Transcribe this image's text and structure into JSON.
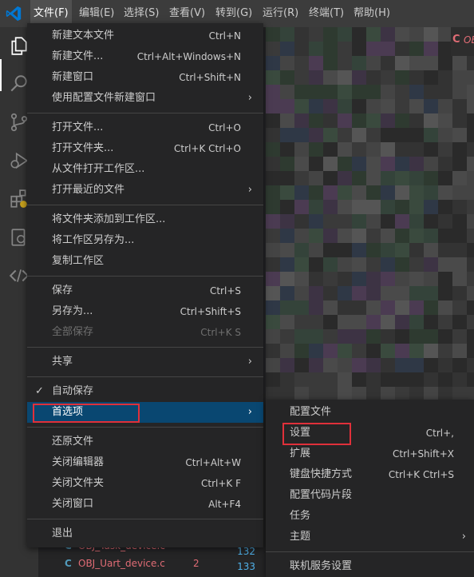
{
  "menubar": {
    "items": [
      "文件(F)",
      "编辑(E)",
      "选择(S)",
      "查看(V)",
      "转到(G)",
      "运行(R)",
      "终端(T)",
      "帮助(H)"
    ]
  },
  "file_menu": {
    "items": [
      {
        "label": "新建文本文件",
        "key": "Ctrl+N"
      },
      {
        "label": "新建文件...",
        "key": "Ctrl+Alt+Windows+N"
      },
      {
        "label": "新建窗口",
        "key": "Ctrl+Shift+N"
      },
      {
        "label": "使用配置文件新建窗口",
        "key": ""
      },
      {
        "label": "打开文件...",
        "key": "Ctrl+O"
      },
      {
        "label": "打开文件夹...",
        "key": "Ctrl+K Ctrl+O"
      },
      {
        "label": "从文件打开工作区...",
        "key": ""
      },
      {
        "label": "打开最近的文件",
        "key": ""
      },
      {
        "label": "将文件夹添加到工作区...",
        "key": ""
      },
      {
        "label": "将工作区另存为...",
        "key": ""
      },
      {
        "label": "复制工作区",
        "key": ""
      },
      {
        "label": "保存",
        "key": "Ctrl+S"
      },
      {
        "label": "另存为...",
        "key": "Ctrl+Shift+S"
      },
      {
        "label": "全部保存",
        "key": "Ctrl+K S"
      },
      {
        "label": "共享",
        "key": ""
      },
      {
        "label": "自动保存",
        "key": ""
      },
      {
        "label": "首选项",
        "key": ""
      },
      {
        "label": "还原文件",
        "key": ""
      },
      {
        "label": "关闭编辑器",
        "key": "Ctrl+Alt+W"
      },
      {
        "label": "关闭文件夹",
        "key": "Ctrl+K F"
      },
      {
        "label": "关闭窗口",
        "key": "Alt+F4"
      },
      {
        "label": "退出",
        "key": ""
      }
    ],
    "check_glyph": "✓",
    "arrow_glyph": "›"
  },
  "preferences_submenu": {
    "items": [
      {
        "label": "配置文件",
        "key": ""
      },
      {
        "label": "设置",
        "key": "Ctrl+,"
      },
      {
        "label": "扩展",
        "key": "Ctrl+Shift+X"
      },
      {
        "label": "键盘快捷方式",
        "key": "Ctrl+K Ctrl+S"
      },
      {
        "label": "配置代码片段",
        "key": ""
      },
      {
        "label": "任务",
        "key": ""
      },
      {
        "label": "主题",
        "key": ""
      },
      {
        "label": "联机服务设置",
        "key": ""
      }
    ]
  },
  "editor": {
    "tab_icon": "C",
    "tab_label": "OBJ"
  },
  "explorer": {
    "rows": [
      {
        "icon": "C",
        "name": "OBJ_Task_device.c",
        "badge": ""
      },
      {
        "icon": "C",
        "name": "OBJ_Uart_device.c",
        "badge": "2"
      }
    ],
    "line_numbers": [
      "132",
      "133"
    ]
  },
  "colors": {
    "menu_bg": "#252526",
    "highlight": "#094771",
    "annotation": "#e0303a",
    "accent_blue": "#0078d4"
  }
}
